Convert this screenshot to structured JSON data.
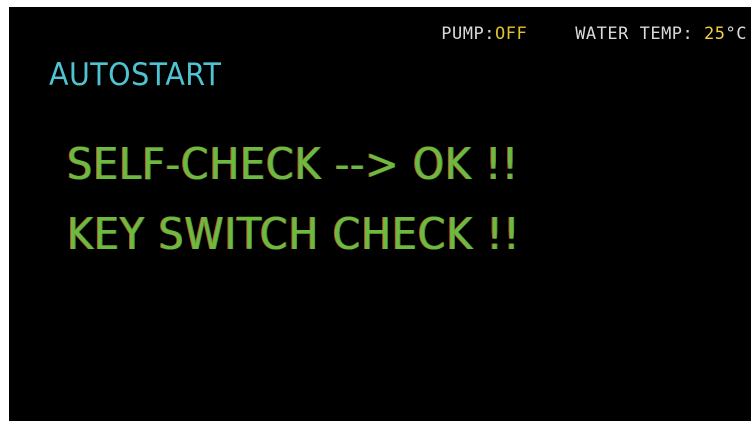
{
  "status": {
    "pump_label": "PUMP:",
    "pump_value": "OFF",
    "temp_label": "WATER TEMP:",
    "temp_value": "25",
    "temp_unit": "°C"
  },
  "mode": {
    "title": "AUTOSTART"
  },
  "messages": [
    {
      "text": "SELF-CHECK --> OK !!"
    },
    {
      "text": "KEY SWITCH CHECK !!"
    }
  ],
  "colors": {
    "background": "#000000",
    "title": "#4ec3d1",
    "message": "#6cba3f",
    "status_text": "#d9d9d9",
    "status_value": "#e0c230"
  }
}
